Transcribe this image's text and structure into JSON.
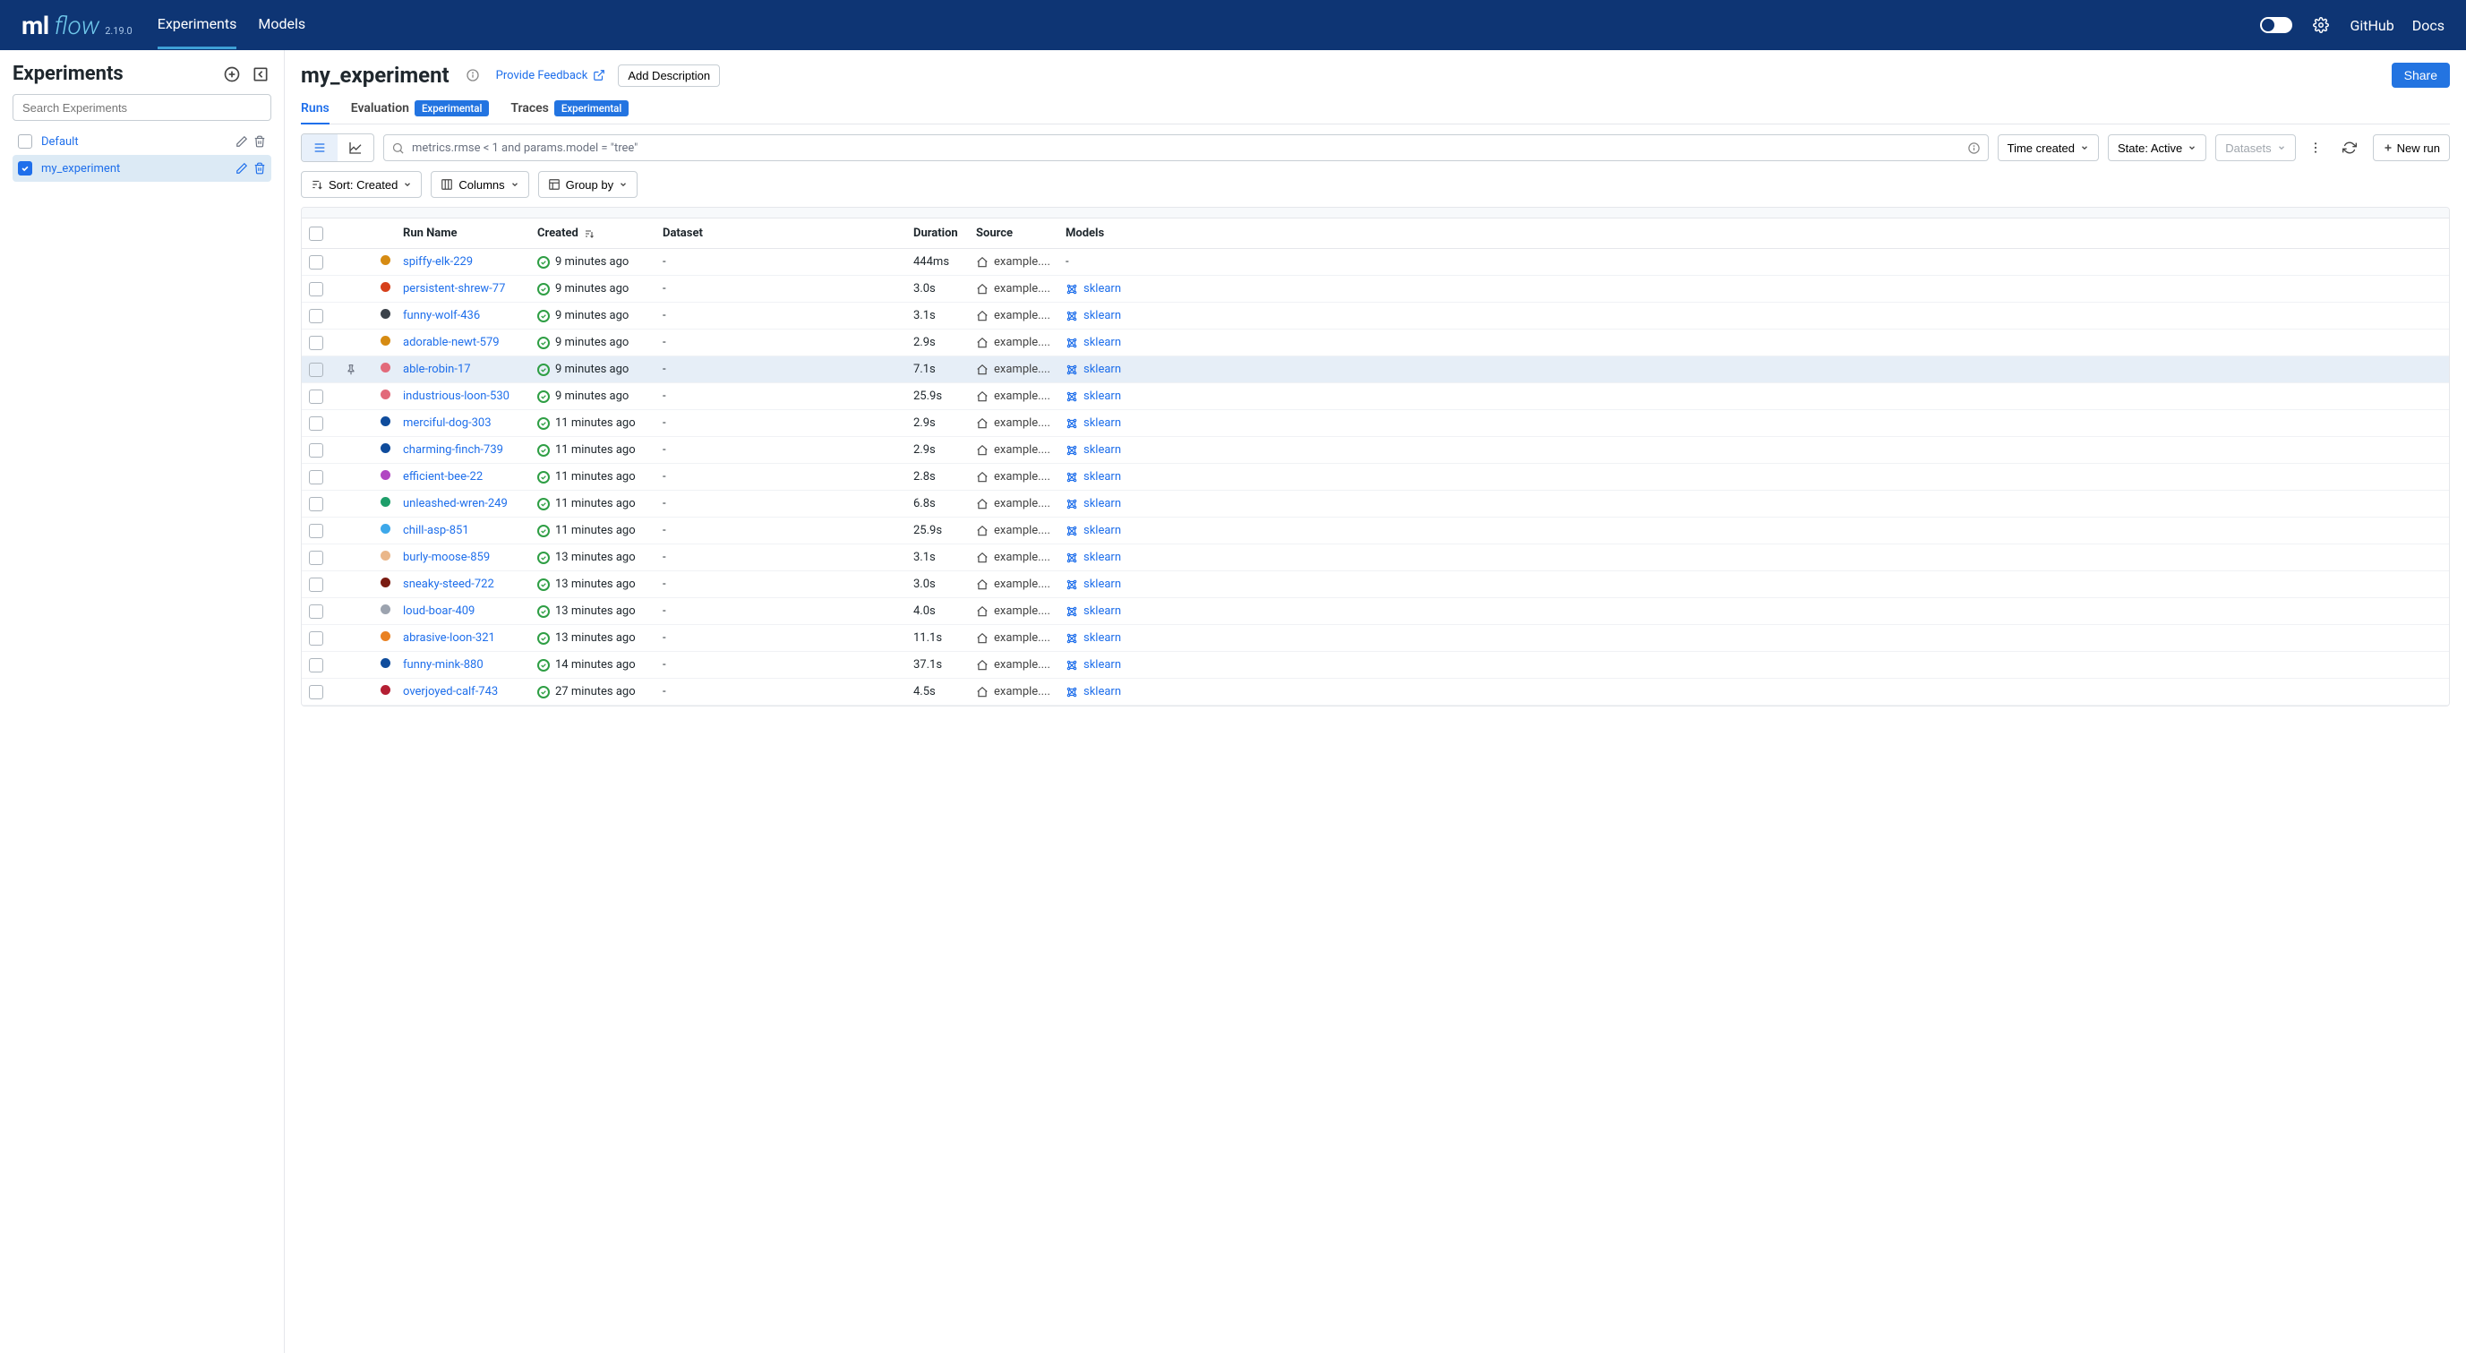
{
  "logo": {
    "ml": "ml",
    "flow": "flow",
    "version": "2.19.0"
  },
  "nav": {
    "experiments": "Experiments",
    "models": "Models"
  },
  "topright": {
    "github": "GitHub",
    "docs": "Docs"
  },
  "sidebar": {
    "title": "Experiments",
    "search_placeholder": "Search Experiments",
    "items": [
      {
        "name": "Default",
        "selected": false,
        "checked": false
      },
      {
        "name": "my_experiment",
        "selected": true,
        "checked": true
      }
    ]
  },
  "page": {
    "title": "my_experiment",
    "feedback": "Provide Feedback",
    "add_desc": "Add Description",
    "share": "Share"
  },
  "subtabs": {
    "runs": "Runs",
    "evaluation": "Evaluation",
    "traces": "Traces",
    "experimental": "Experimental"
  },
  "toolbar": {
    "search_placeholder": "metrics.rmse < 1 and params.model = \"tree\"",
    "time_created": "Time created",
    "state": "State: Active",
    "datasets": "Datasets",
    "new_run": "New run",
    "sort": "Sort: Created",
    "columns": "Columns",
    "group_by": "Group by"
  },
  "columns": {
    "run_name": "Run Name",
    "created": "Created",
    "dataset": "Dataset",
    "duration": "Duration",
    "source": "Source",
    "models": "Models"
  },
  "source_label": "example....",
  "model_label": "sklearn",
  "runs": [
    {
      "name": "spiffy-elk-229",
      "color": "#d68b13",
      "created": "9 minutes ago",
      "dataset": "-",
      "duration": "444ms",
      "model": "-"
    },
    {
      "name": "persistent-shrew-77",
      "color": "#d6401b",
      "created": "9 minutes ago",
      "dataset": "-",
      "duration": "3.0s",
      "model": "sklearn"
    },
    {
      "name": "funny-wolf-436",
      "color": "#3b424a",
      "created": "9 minutes ago",
      "dataset": "-",
      "duration": "3.1s",
      "model": "sklearn"
    },
    {
      "name": "adorable-newt-579",
      "color": "#d68b13",
      "created": "9 minutes ago",
      "dataset": "-",
      "duration": "2.9s",
      "model": "sklearn"
    },
    {
      "name": "able-robin-17",
      "color": "#e26a7a",
      "created": "9 minutes ago",
      "dataset": "-",
      "duration": "7.1s",
      "model": "sklearn",
      "hover": true
    },
    {
      "name": "industrious-loon-530",
      "color": "#e26a7a",
      "created": "9 minutes ago",
      "dataset": "-",
      "duration": "25.9s",
      "model": "sklearn"
    },
    {
      "name": "merciful-dog-303",
      "color": "#0f4c9c",
      "created": "11 minutes ago",
      "dataset": "-",
      "duration": "2.9s",
      "model": "sklearn"
    },
    {
      "name": "charming-finch-739",
      "color": "#0f4c9c",
      "created": "11 minutes ago",
      "dataset": "-",
      "duration": "2.9s",
      "model": "sklearn"
    },
    {
      "name": "efficient-bee-22",
      "color": "#b146c2",
      "created": "11 minutes ago",
      "dataset": "-",
      "duration": "2.8s",
      "model": "sklearn"
    },
    {
      "name": "unleashed-wren-249",
      "color": "#1e9e6a",
      "created": "11 minutes ago",
      "dataset": "-",
      "duration": "6.8s",
      "model": "sklearn"
    },
    {
      "name": "chill-asp-851",
      "color": "#3da8ea",
      "created": "11 minutes ago",
      "dataset": "-",
      "duration": "25.9s",
      "model": "sklearn"
    },
    {
      "name": "burly-moose-859",
      "color": "#eab78a",
      "created": "13 minutes ago",
      "dataset": "-",
      "duration": "3.1s",
      "model": "sklearn"
    },
    {
      "name": "sneaky-steed-722",
      "color": "#7a1c12",
      "created": "13 minutes ago",
      "dataset": "-",
      "duration": "3.0s",
      "model": "sklearn"
    },
    {
      "name": "loud-boar-409",
      "color": "#9ca3af",
      "created": "13 minutes ago",
      "dataset": "-",
      "duration": "4.0s",
      "model": "sklearn"
    },
    {
      "name": "abrasive-loon-321",
      "color": "#e98122",
      "created": "13 minutes ago",
      "dataset": "-",
      "duration": "11.1s",
      "model": "sklearn"
    },
    {
      "name": "funny-mink-880",
      "color": "#0f4c9c",
      "created": "14 minutes ago",
      "dataset": "-",
      "duration": "37.1s",
      "model": "sklearn"
    },
    {
      "name": "overjoyed-calf-743",
      "color": "#b41f33",
      "created": "27 minutes ago",
      "dataset": "-",
      "duration": "4.5s",
      "model": "sklearn"
    }
  ]
}
